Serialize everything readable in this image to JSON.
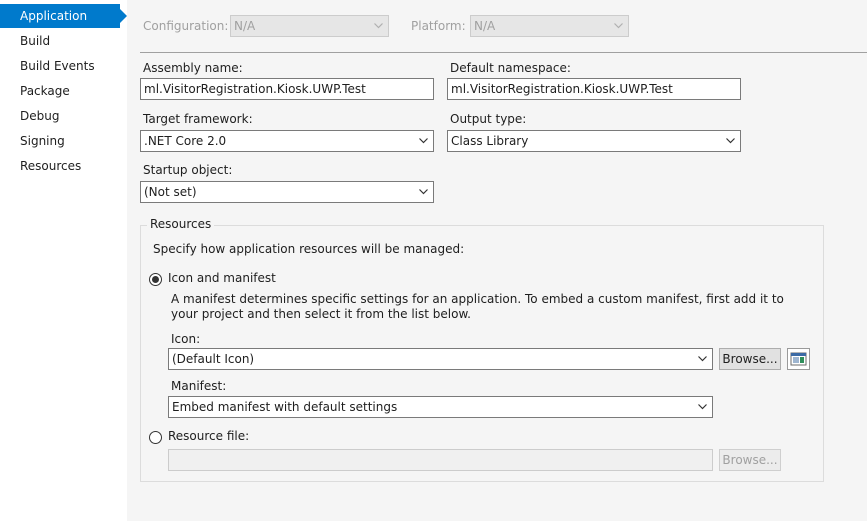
{
  "sidebar": {
    "items": [
      {
        "label": "Application",
        "selected": true
      },
      {
        "label": "Build"
      },
      {
        "label": "Build Events"
      },
      {
        "label": "Package"
      },
      {
        "label": "Debug"
      },
      {
        "label": "Signing"
      },
      {
        "label": "Resources"
      }
    ]
  },
  "toolbar": {
    "configuration_label": "Configuration:",
    "configuration_value": "N/A",
    "platform_label": "Platform:",
    "platform_value": "N/A"
  },
  "form": {
    "assembly_name_label": "Assembly name:",
    "assembly_name_value": "ml.VisitorRegistration.Kiosk.UWP.Test",
    "default_namespace_label": "Default namespace:",
    "default_namespace_value": "ml.VisitorRegistration.Kiosk.UWP.Test",
    "target_framework_label": "Target framework:",
    "target_framework_value": ".NET Core 2.0",
    "output_type_label": "Output type:",
    "output_type_value": "Class Library",
    "startup_object_label": "Startup object:",
    "startup_object_value": "(Not set)"
  },
  "resources": {
    "group_title": "Resources",
    "description": "Specify how application resources will be managed:",
    "icon_and_manifest_label": "Icon and manifest",
    "icon_and_manifest_checked": true,
    "manifest_help_line1": "A manifest determines specific settings for an application. To embed a custom manifest, first add it to",
    "manifest_help_line2": "your project and then select it from the list below.",
    "icon_label": "Icon:",
    "icon_value": "(Default Icon)",
    "browse_label": "Browse...",
    "manifest_label": "Manifest:",
    "manifest_value": "Embed manifest with default settings",
    "resource_file_label": "Resource file:",
    "resource_file_checked": false,
    "resource_file_value": "",
    "resource_browse_label": "Browse..."
  },
  "colors": {
    "accent": "#007acc",
    "background": "#f5f5f5",
    "sidebar": "#ffffff"
  }
}
